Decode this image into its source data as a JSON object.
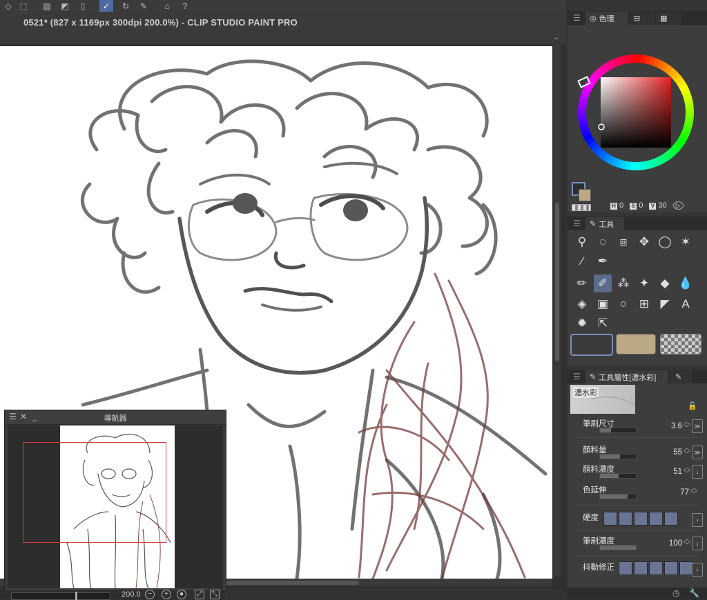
{
  "document": {
    "title": "0521* (827 x 1169px 300dpi 200.0%)  - CLIP STUDIO PAINT PRO"
  },
  "toolbar": {
    "icons": [
      "layer-icon",
      "select-icon",
      "fill-icon",
      "tone-icon",
      "stop-icon",
      "check-icon",
      "rotate-icon",
      "pen-edit-icon",
      "learn-icon",
      "help-icon"
    ]
  },
  "navigator": {
    "title": "導航器",
    "zoom": "200.0",
    "zoom_minus": "−",
    "zoom_plus": "+"
  },
  "color_panel": {
    "tab_label": "色環",
    "h_label": "H",
    "h_value": "0",
    "s_label": "S",
    "s_value": "0",
    "v_label": "V",
    "v_value": "30",
    "main_color": "#2e2e2e",
    "sub_color": "#bba983",
    "wheel_marker_color": "#e53030"
  },
  "tool_panel": {
    "tab_label": "工具"
  },
  "tool_property": {
    "tab_label": "工具屬性[濃水彩]",
    "preview_name": "濃水彩",
    "brush_size": {
      "label": "筆刷尺寸",
      "value": "3.6"
    },
    "paint_amount": {
      "label": "顏料量",
      "value": "55"
    },
    "paint_density": {
      "label": "顏料濃度",
      "value": "51"
    },
    "color_stretch": {
      "label": "色延伸",
      "value": "77"
    },
    "hardness": {
      "label": "硬度"
    },
    "brush_density": {
      "label": "筆刷濃度",
      "value": "100"
    },
    "stabilization": {
      "label": "抖動修正"
    }
  },
  "swatches": [
    "#3a3a3a",
    "#bba983",
    "transparent"
  ]
}
